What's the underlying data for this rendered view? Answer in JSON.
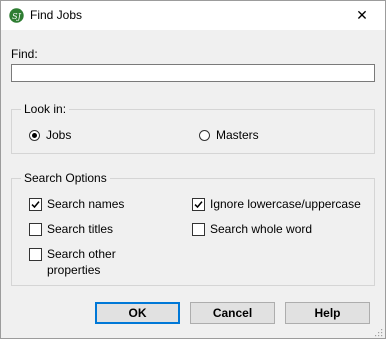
{
  "window": {
    "title": "Find Jobs",
    "app_icon_letter": "SJ",
    "close_glyph": "✕"
  },
  "find": {
    "label": "Find:",
    "value": "",
    "placeholder": ""
  },
  "look_in": {
    "legend": "Look in:",
    "options": [
      {
        "label": "Jobs",
        "selected": true
      },
      {
        "label": "Masters",
        "selected": false
      }
    ]
  },
  "search_options": {
    "legend": "Search Options",
    "items": [
      {
        "label": "Search names",
        "checked": true
      },
      {
        "label": "Search titles",
        "checked": false
      },
      {
        "label": "Search other properties",
        "checked": false
      },
      {
        "label": "Ignore lowercase/uppercase",
        "checked": true
      },
      {
        "label": "Search whole word",
        "checked": false
      }
    ]
  },
  "buttons": {
    "ok": "OK",
    "cancel": "Cancel",
    "help": "Help"
  },
  "colors": {
    "app_icon": "#2e7d32",
    "default_button_border": "#0078d7",
    "dialog_background": "#f0f0f0"
  },
  "icons": {
    "app": "app-logo-icon",
    "close": "close-icon",
    "checkmark": "checkmark-icon",
    "resize_grip": "resize-grip-icon"
  }
}
